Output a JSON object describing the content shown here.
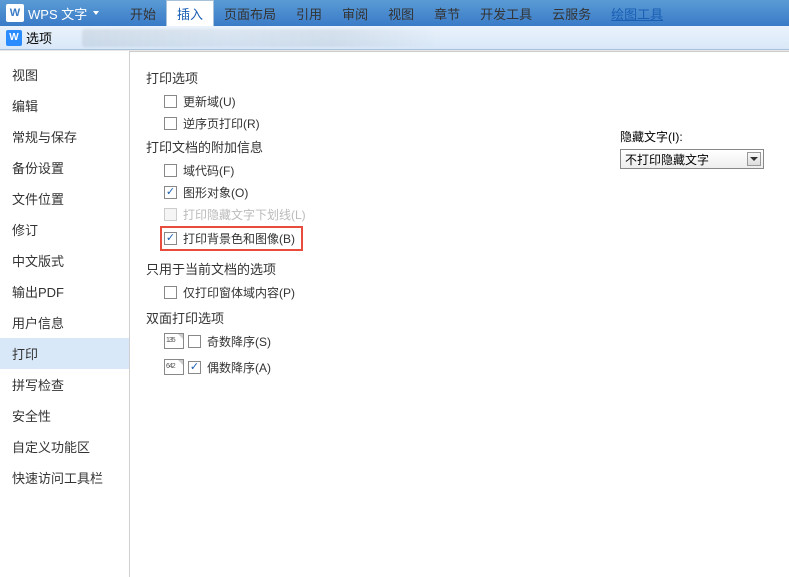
{
  "app": {
    "logo": "W",
    "title": "WPS 文字"
  },
  "menu": {
    "items": [
      "开始",
      "插入",
      "页面布局",
      "引用",
      "审阅",
      "视图",
      "章节",
      "开发工具",
      "云服务",
      "绘图工具"
    ],
    "activeIndex": 1
  },
  "dialog": {
    "logo": "W",
    "title": "选项"
  },
  "sidebar": {
    "items": [
      "视图",
      "编辑",
      "常规与保存",
      "备份设置",
      "文件位置",
      "修订",
      "中文版式",
      "输出PDF",
      "用户信息",
      "打印",
      "拼写检查",
      "安全性",
      "自定义功能区",
      "快速访问工具栏"
    ],
    "selectedIndex": 9
  },
  "content": {
    "printOptions": {
      "title": "打印选项",
      "updateFields": "更新域(U)",
      "reverseOrder": "逆序页打印(R)"
    },
    "printDocExtra": {
      "title": "打印文档的附加信息",
      "fieldCodes": "域代码(F)",
      "drawingObjects": "图形对象(O)",
      "hiddenUnderline": "打印隐藏文字下划线(L)",
      "bgAndImages": "打印背景色和图像(B)"
    },
    "hiddenText": {
      "label": "隐藏文字(I):",
      "value": "不打印隐藏文字"
    },
    "currentDocOnly": {
      "title": "只用于当前文档的选项",
      "formContentOnly": "仅打印窗体域内容(P)"
    },
    "duplex": {
      "title": "双面打印选项",
      "oddDesc": "奇数降序(S)",
      "evenDesc": "偶数降序(A)"
    }
  }
}
